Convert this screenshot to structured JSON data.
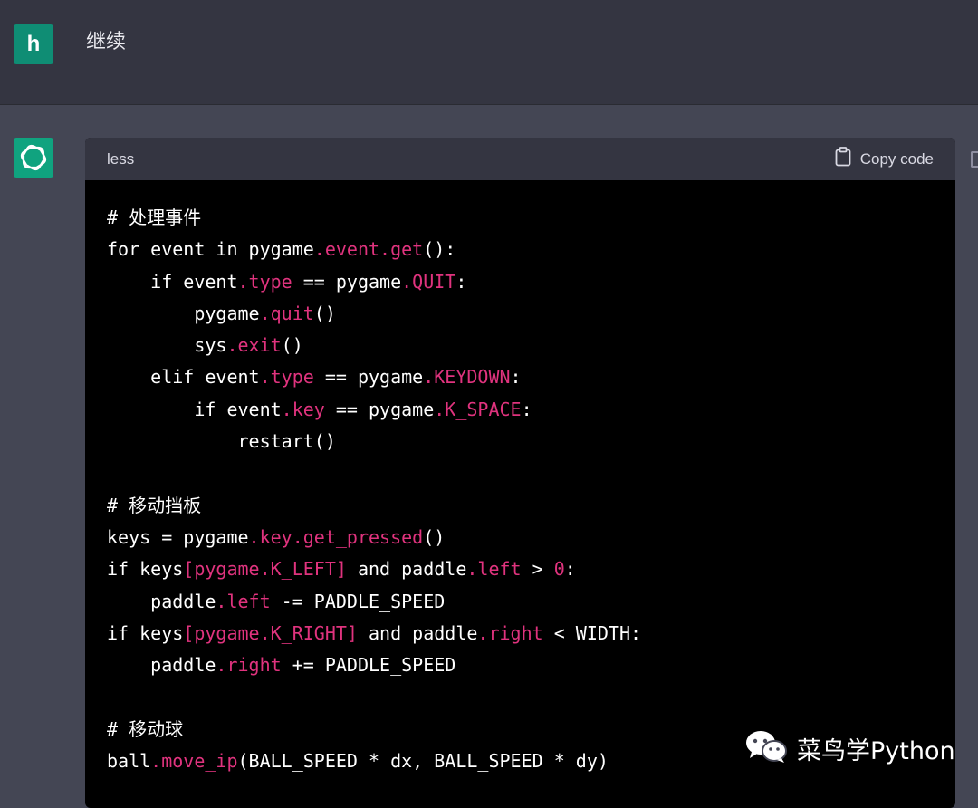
{
  "user": {
    "avatar_letter": "h",
    "message": "继续"
  },
  "code_block": {
    "language": "less",
    "copy_label": "Copy code",
    "lines": [
      [
        {
          "t": "# 处理事件",
          "c": "comment"
        }
      ],
      [
        {
          "t": "for event in pygame",
          "c": "plain"
        },
        {
          "t": ".event.get",
          "c": "member"
        },
        {
          "t": "():",
          "c": "plain"
        }
      ],
      [
        {
          "t": "    if event",
          "c": "plain"
        },
        {
          "t": ".type",
          "c": "member"
        },
        {
          "t": " == pygame",
          "c": "plain"
        },
        {
          "t": ".QUIT",
          "c": "member"
        },
        {
          "t": ":",
          "c": "plain"
        }
      ],
      [
        {
          "t": "        pygame",
          "c": "plain"
        },
        {
          "t": ".quit",
          "c": "member"
        },
        {
          "t": "()",
          "c": "plain"
        }
      ],
      [
        {
          "t": "        sys",
          "c": "plain"
        },
        {
          "t": ".exit",
          "c": "member"
        },
        {
          "t": "()",
          "c": "plain"
        }
      ],
      [
        {
          "t": "    elif event",
          "c": "plain"
        },
        {
          "t": ".type",
          "c": "member"
        },
        {
          "t": " == pygame",
          "c": "plain"
        },
        {
          "t": ".KEYDOWN",
          "c": "member"
        },
        {
          "t": ":",
          "c": "plain"
        }
      ],
      [
        {
          "t": "        if event",
          "c": "plain"
        },
        {
          "t": ".key",
          "c": "member"
        },
        {
          "t": " == pygame",
          "c": "plain"
        },
        {
          "t": ".K_SPACE",
          "c": "member"
        },
        {
          "t": ":",
          "c": "plain"
        }
      ],
      [
        {
          "t": "            restart()",
          "c": "plain"
        }
      ],
      [
        {
          "t": "",
          "c": "plain"
        }
      ],
      [
        {
          "t": "# 移动挡板",
          "c": "comment"
        }
      ],
      [
        {
          "t": "keys = pygame",
          "c": "plain"
        },
        {
          "t": ".key.get_pressed",
          "c": "member"
        },
        {
          "t": "()",
          "c": "plain"
        }
      ],
      [
        {
          "t": "if keys",
          "c": "plain"
        },
        {
          "t": "[pygame.K_LEFT]",
          "c": "member"
        },
        {
          "t": " and paddle",
          "c": "plain"
        },
        {
          "t": ".left",
          "c": "member"
        },
        {
          "t": " > ",
          "c": "plain"
        },
        {
          "t": "0",
          "c": "member"
        },
        {
          "t": ":",
          "c": "plain"
        }
      ],
      [
        {
          "t": "    paddle",
          "c": "plain"
        },
        {
          "t": ".left",
          "c": "member"
        },
        {
          "t": " -= PADDLE_SPEED",
          "c": "plain"
        }
      ],
      [
        {
          "t": "if keys",
          "c": "plain"
        },
        {
          "t": "[pygame.K_RIGHT]",
          "c": "member"
        },
        {
          "t": " and paddle",
          "c": "plain"
        },
        {
          "t": ".right",
          "c": "member"
        },
        {
          "t": " < WIDTH:",
          "c": "plain"
        }
      ],
      [
        {
          "t": "    paddle",
          "c": "plain"
        },
        {
          "t": ".right",
          "c": "member"
        },
        {
          "t": " += PADDLE_SPEED",
          "c": "plain"
        }
      ],
      [
        {
          "t": "",
          "c": "plain"
        }
      ],
      [
        {
          "t": "# 移动球",
          "c": "comment"
        }
      ],
      [
        {
          "t": "ball",
          "c": "plain"
        },
        {
          "t": ".move_ip",
          "c": "member"
        },
        {
          "t": "(BALL_SPEED * dx, BALL_SPEED * dy)",
          "c": "plain"
        }
      ]
    ]
  },
  "watermark": {
    "text": "菜鸟学Python",
    "icon": "wechat-icon"
  },
  "colors": {
    "user_bg": "#343541",
    "assistant_bg": "#444654",
    "avatar_user": "#0f8d74",
    "avatar_gpt": "#10a37f",
    "code_bg": "#000000",
    "code_header_bg": "#343541",
    "member_token": "#e0337e"
  }
}
